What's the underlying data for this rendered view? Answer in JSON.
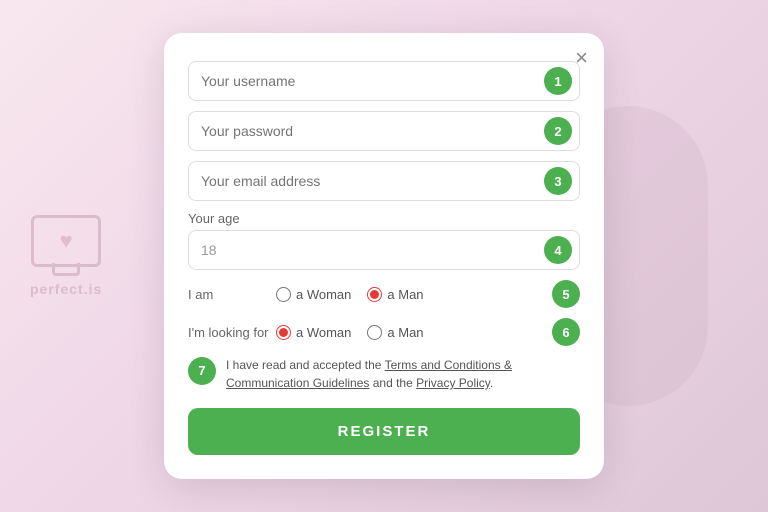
{
  "watermark": {
    "text": "perfect.is"
  },
  "modal": {
    "close_label": "×",
    "fields": {
      "username": {
        "placeholder": "Your username",
        "step": "1"
      },
      "password": {
        "placeholder": "Your password",
        "step": "2"
      },
      "email": {
        "placeholder": "Your email address",
        "step": "3"
      },
      "age": {
        "label": "Your age",
        "value": "18",
        "step": "4"
      }
    },
    "iam_section": {
      "label": "I am",
      "step": "5",
      "options": [
        {
          "id": "iam-woman",
          "value": "woman",
          "label": "a Woman",
          "checked": false
        },
        {
          "id": "iam-man",
          "value": "man",
          "label": "a Man",
          "checked": true
        }
      ]
    },
    "looking_section": {
      "label": "I'm looking for",
      "step": "6",
      "options": [
        {
          "id": "look-woman",
          "value": "woman",
          "label": "a Woman",
          "checked": true
        },
        {
          "id": "look-man",
          "value": "man",
          "label": "a Man",
          "checked": false
        }
      ]
    },
    "terms": {
      "step": "7",
      "text_before": "I have read and accepted the ",
      "link1": "Terms and Conditions & Communication Guidelines",
      "text_mid": " and the ",
      "link2": "Privacy Policy",
      "text_end": "."
    },
    "register_button": "REGISTER"
  }
}
